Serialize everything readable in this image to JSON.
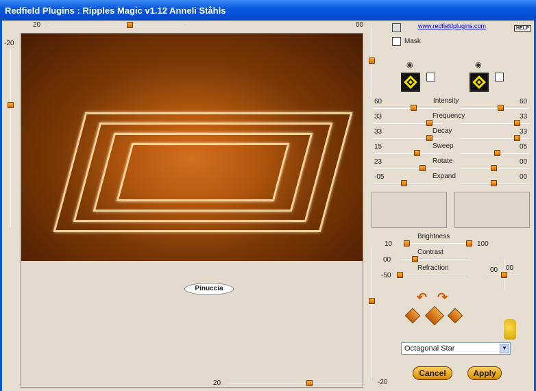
{
  "window": {
    "title": "Redfield Plugins : Ripples Magic v1.12   Anneli Ståhls"
  },
  "preview": {
    "top_slider_value": "20",
    "top_slider_right": "00",
    "left_slider_value": "-20",
    "bottom_slider_value": "20",
    "watermark": "Pinuccia"
  },
  "header": {
    "link": "www.redfieldplugins.com",
    "help": "HELP",
    "mask_label": "Mask"
  },
  "sliders": [
    {
      "name": "Intensity",
      "left": "60",
      "right": "60"
    },
    {
      "name": "Frequency",
      "left": "33",
      "right": "33"
    },
    {
      "name": "Decay",
      "left": "33",
      "right": "33"
    },
    {
      "name": "Sweep",
      "left": "15",
      "right": "05"
    },
    {
      "name": "Rotate",
      "left": "23",
      "right": "00"
    },
    {
      "name": "Expand",
      "left": "-05",
      "right": "00"
    }
  ],
  "lighting": {
    "brightness_label": "Brightness",
    "brightness_min": "10",
    "brightness_max": "100",
    "contrast_label": "Contrast",
    "contrast_value": "00",
    "refraction_label": "Refraction",
    "refraction_value": "-50",
    "xy_x": "00",
    "xy_y": "00",
    "right_vertical_value": "-20"
  },
  "preset": {
    "selected": "Octagonal Star"
  },
  "buttons": {
    "cancel": "Cancel",
    "apply": "Apply"
  },
  "colors": {
    "accent": "#e08000",
    "titlebar": "#0a5ae0"
  }
}
